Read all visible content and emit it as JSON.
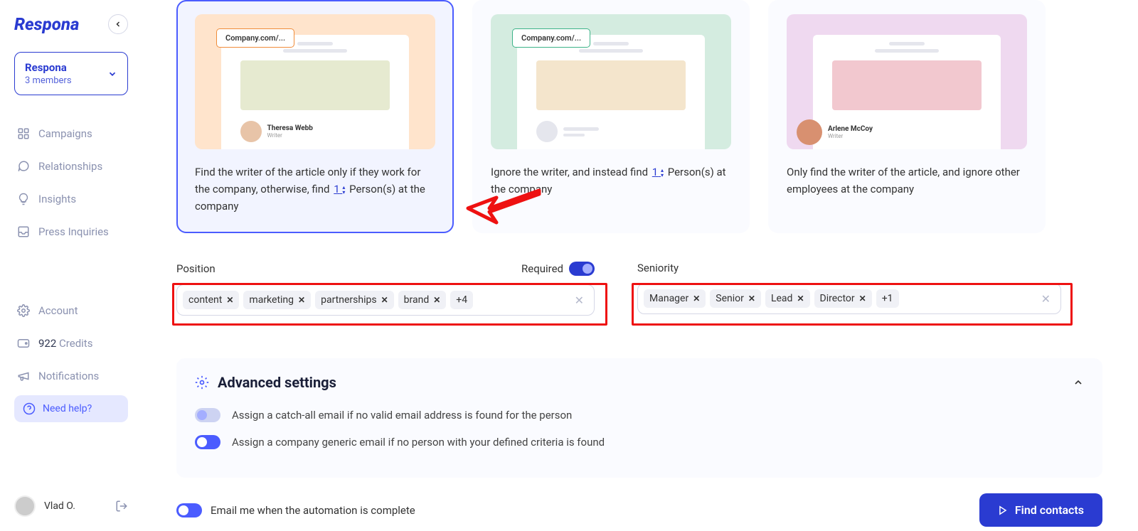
{
  "brand": "Respona",
  "workspace": {
    "name": "Respona",
    "members": "3 members"
  },
  "nav": {
    "campaigns": "Campaigns",
    "relationships": "Relationships",
    "insights": "Insights",
    "press": "Press Inquiries",
    "account": "Account",
    "credits_num": "922",
    "credits_label": "Credits",
    "notifications": "Notifications",
    "help": "Need help?"
  },
  "user": {
    "name": "Vlad O."
  },
  "cards": {
    "url_tag": "Company.com/...",
    "c1": {
      "author": "Theresa Webb",
      "role": "Writer",
      "text_a": "Find the writer of the article only if they work for the company, otherwise, find ",
      "num": "1",
      "text_b": " Person(s) at the company"
    },
    "c2": {
      "text_a": "Ignore the writer, and instead find ",
      "num": "1",
      "text_b": " Person(s) at the company"
    },
    "c3": {
      "author": "Arlene McCoy",
      "role": "Writer",
      "text": "Only find the writer of the article, and ignore other employees at the company"
    }
  },
  "filters": {
    "position": {
      "label": "Position",
      "required_label": "Required",
      "tags": [
        "content",
        "marketing",
        "partnerships",
        "brand"
      ],
      "more": "+4"
    },
    "seniority": {
      "label": "Seniority",
      "tags": [
        "Manager",
        "Senior",
        "Lead",
        "Director"
      ],
      "more": "+1"
    }
  },
  "advanced": {
    "title": "Advanced settings",
    "opt1": "Assign a catch-all email if no valid email address is found for the person",
    "opt2": "Assign a company generic email if no person with your defined criteria is found"
  },
  "footer": {
    "email_me": "Email me when the automation is complete",
    "find_btn": "Find contacts"
  }
}
